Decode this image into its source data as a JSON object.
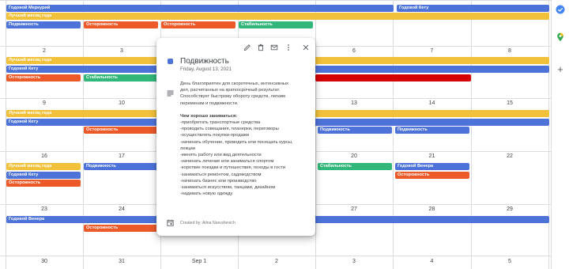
{
  "calendar": {
    "day_numbers": [
      [
        "",
        "",
        "",
        "",
        "",
        "",
        ""
      ],
      [
        "2",
        "3",
        "4",
        "5",
        "6",
        "7",
        "8"
      ],
      [
        "9",
        "10",
        "11",
        "12",
        "13",
        "14",
        "15"
      ],
      [
        "16",
        "17",
        "18",
        "19",
        "20",
        "21",
        "22"
      ],
      [
        "23",
        "24",
        "25",
        "26",
        "27",
        "28",
        "29"
      ],
      [
        "30",
        "31",
        "Sep 1",
        "2",
        "3",
        "4",
        "5"
      ]
    ],
    "events": [
      {
        "title": "Годовой Меркурий",
        "color": "blue"
      },
      {
        "title": "Годовой Кету",
        "color": "blue"
      },
      {
        "title": "Лучший месяц года",
        "color": "yellow"
      },
      {
        "title": "Подвижность",
        "color": "blue"
      },
      {
        "title": "Осторожность",
        "color": "orange"
      },
      {
        "title": "Осторожность",
        "color": "orange"
      },
      {
        "title": "Стабильность",
        "color": "green"
      },
      {
        "title": "Лучший месяц года",
        "color": "yellow"
      },
      {
        "title": "Годовой Кету",
        "color": "blue"
      },
      {
        "title": "Осторожность",
        "color": "orange"
      },
      {
        "title": "Стабильность",
        "color": "green"
      },
      {
        "title": "",
        "color": "red"
      },
      {
        "title": "Лучший месяц года",
        "color": "yellow"
      },
      {
        "title": "Годовой Кету",
        "color": "blue"
      },
      {
        "title": "Осторожность",
        "color": "orange"
      },
      {
        "title": "Подвижность",
        "color": "blue"
      },
      {
        "title": "Подвижность",
        "color": "blue"
      },
      {
        "title": "Лучший месяц года",
        "color": "yellow"
      },
      {
        "title": "Подвижность",
        "color": "blue"
      },
      {
        "title": "Годовой Кету",
        "color": "blue"
      },
      {
        "title": "Стабильность",
        "color": "green"
      },
      {
        "title": "Годовой Венера",
        "color": "blue"
      },
      {
        "title": "Осторожность",
        "color": "orange"
      },
      {
        "title": "Осторожность",
        "color": "orange"
      },
      {
        "title": "Годовой Венера",
        "color": "blue"
      },
      {
        "title": "Осторожность",
        "color": "orange"
      },
      {
        "title": "Осторожность",
        "color": "orange"
      }
    ]
  },
  "colors": {
    "blue": "#4d73d9",
    "yellow": "#f2c13c",
    "orange": "#ec5a2a",
    "green": "#33b679",
    "red": "#d50000"
  },
  "popup": {
    "title": "Подвижность",
    "date": "Friday, August 13, 2021",
    "description_lines": [
      "День благоприятен для скоротечных, интенсивных",
      "дел, расчитанных на краткосрочный результат.",
      "Способствует быстрому обороту средств, легким",
      "переменам и подвижности."
    ],
    "list_heading": "Чем хорошо заниматься:",
    "list_items": [
      "-приобретать транспортные средства",
      "-проводить совещания, планерки, переговоры",
      "-осуществлять покупки-продажи",
      "-начинать обучение, проводить или посещать курсы,",
      "лекции",
      "-менять работу или вид деятельности",
      "-начинать лечение или заниматься спортом",
      "-короткие поездки и путешествия, походы в гости",
      "-заниматься ремонтом, садоводством",
      "-начинать бизнес или производство",
      "-заниматься искусством, танцами, дизайном",
      "-надевать новую одежду"
    ],
    "creator": "Created by: Alina Narushevich",
    "toolbar_icons": [
      "edit-icon",
      "delete-icon",
      "email-icon",
      "more-options-icon",
      "close-icon"
    ]
  },
  "side_panel": {
    "icons": [
      "tasks-icon",
      "maps-icon",
      "add-icon"
    ]
  }
}
